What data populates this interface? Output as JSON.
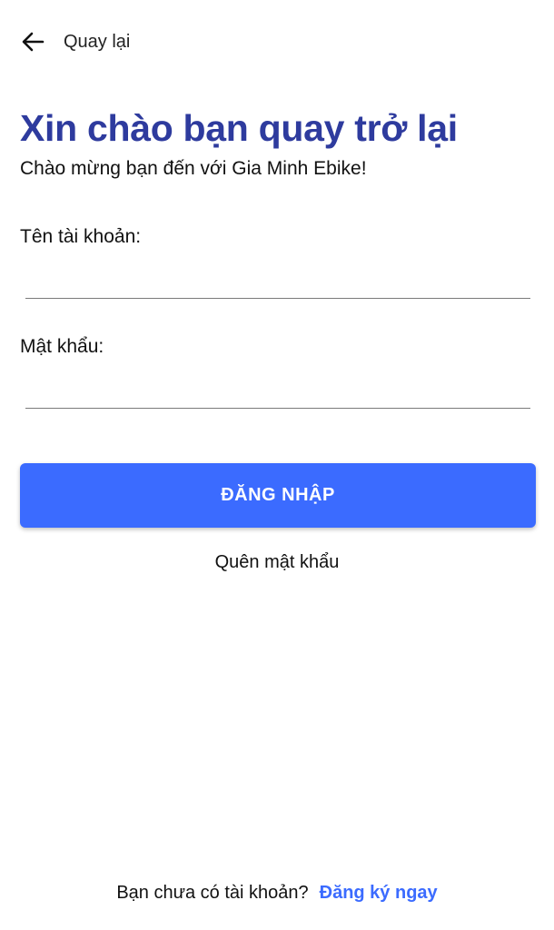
{
  "header": {
    "back_label": "Quay lại",
    "back_icon": "arrow-left-icon"
  },
  "main": {
    "title": "Xin chào bạn quay trở lại",
    "subtitle": "Chào mừng bạn đến với Gia Minh Ebike!",
    "username_label": "Tên tài khoản:",
    "username_value": "",
    "password_label": "Mật khẩu:",
    "password_value": "",
    "login_button": "ĐĂNG NHẬP",
    "forgot_password": "Quên mật khẩu"
  },
  "footer": {
    "prompt": "Bạn chưa có tài khoản?",
    "signup_link": "Đăng ký ngay"
  },
  "colors": {
    "title": "#2e3b9e",
    "accent": "#3b6bff",
    "background": "#ffffff"
  }
}
